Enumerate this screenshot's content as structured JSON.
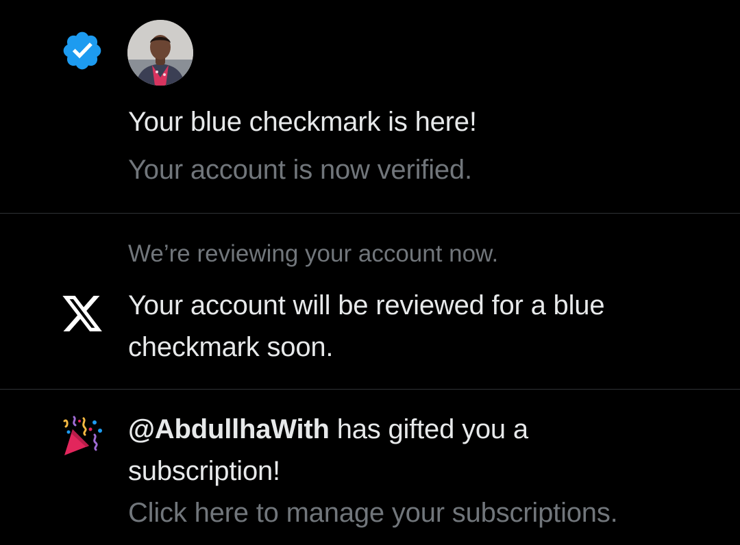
{
  "notifications": [
    {
      "icon": "verified-badge-icon",
      "title": "Your blue checkmark is here!",
      "subtitle": "Your account is now verified."
    },
    {
      "icon": "x-logo-icon",
      "header": "We’re reviewing your account now.",
      "body": "Your account will be reviewed for a blue checkmark soon."
    },
    {
      "icon": "party-popper-icon",
      "handle": "@AbdullhaWith",
      "body_suffix": " has gifted you a subscription!",
      "subtitle": "Click here to manage your subscriptions."
    }
  ],
  "colors": {
    "background": "#000000",
    "primary_text": "#e7e9ea",
    "secondary_text": "#71767b",
    "divider": "#2f3336",
    "verified_blue": "#1d9bf0",
    "popper_pink": "#e2265c"
  }
}
